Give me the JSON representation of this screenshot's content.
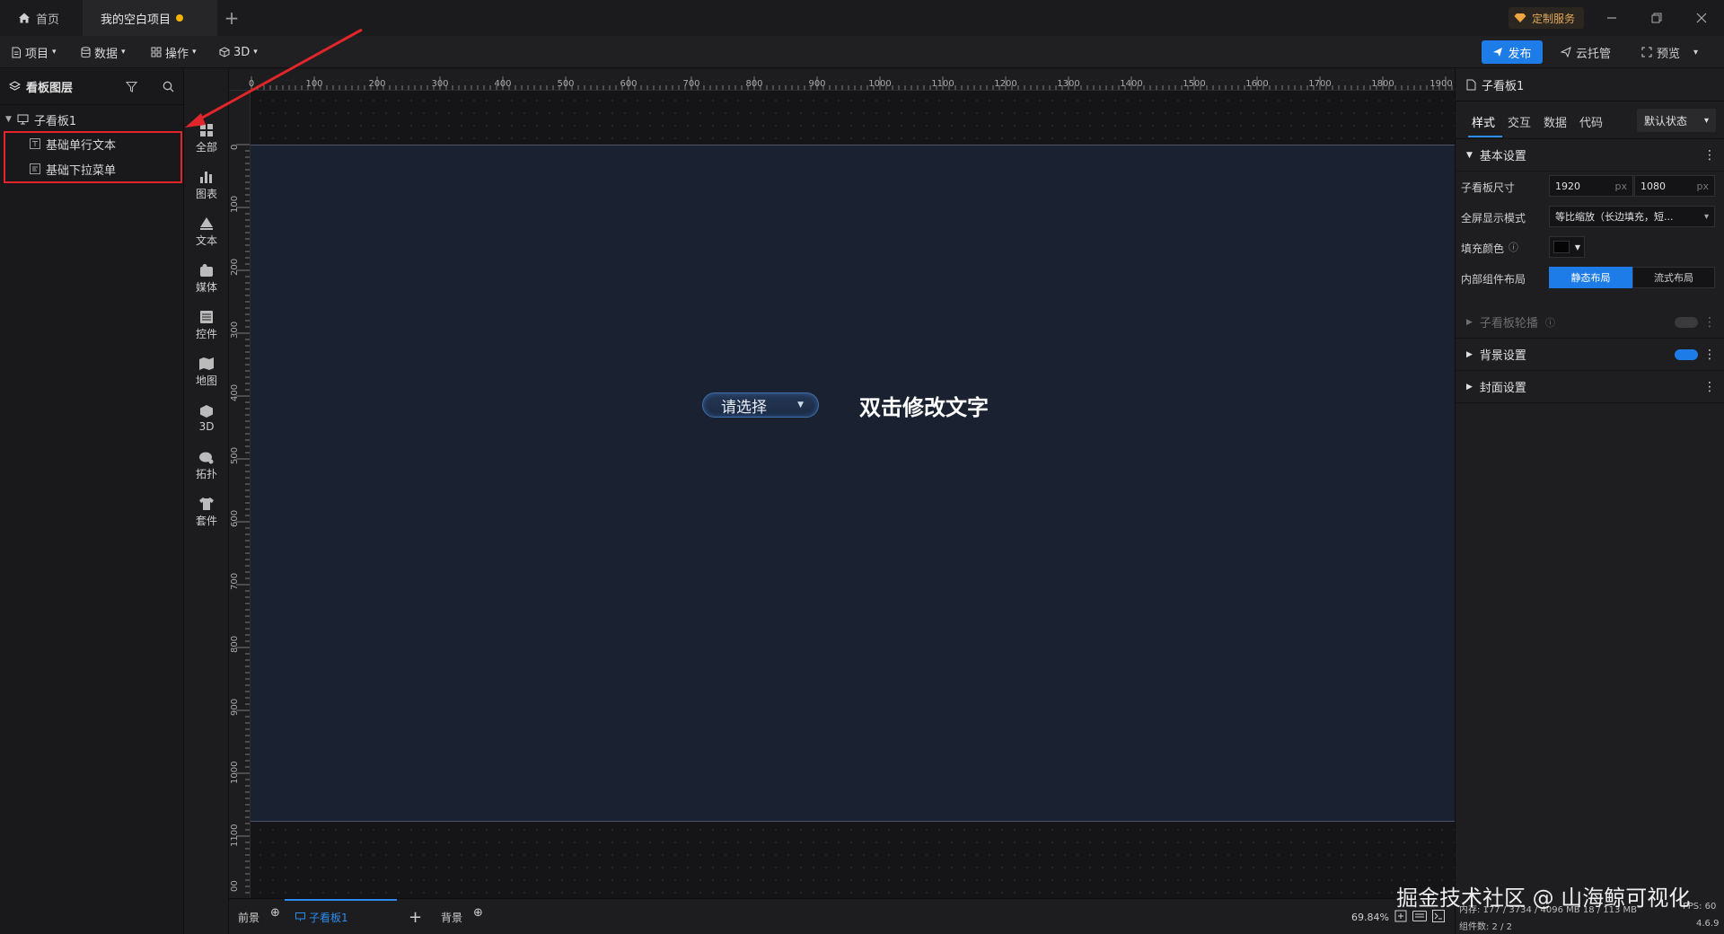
{
  "tabs": {
    "home": "首页",
    "project": "我的空白项目"
  },
  "header": {
    "custom_service": "定制服务"
  },
  "menubar": {
    "project": "项目",
    "data": "数据",
    "operate": "操作",
    "three_d": "3D",
    "publish": "发布",
    "cloud_host": "云托管",
    "preview": "预览"
  },
  "layers": {
    "title": "看板图层",
    "root": "子看板1",
    "children": [
      "基础单行文本",
      "基础下拉菜单"
    ]
  },
  "rail": [
    "全部",
    "图表",
    "文本",
    "媒体",
    "控件",
    "地图",
    "3D",
    "拓扑",
    "套件"
  ],
  "ruler": {
    "top": [
      "0",
      "100",
      "200",
      "300",
      "400",
      "500",
      "600",
      "700",
      "800",
      "900",
      "1000",
      "1100",
      "1200",
      "1300",
      "1400",
      "1500",
      "1600",
      "1700",
      "1800",
      "1900"
    ],
    "left": [
      "0",
      "100",
      "200",
      "300",
      "400",
      "500",
      "600",
      "700",
      "800",
      "900",
      "1000",
      "1100",
      "00"
    ]
  },
  "canvas": {
    "dropdown_placeholder": "请选择",
    "text": "双击修改文字"
  },
  "bottombar": {
    "foreground": "前景",
    "subboard": "子看板1",
    "background": "背景",
    "zoom": "69.84%"
  },
  "props": {
    "title": "子看板1",
    "tabs": [
      "样式",
      "交互",
      "数据",
      "代码"
    ],
    "state": "默认状态",
    "basic_section": "基本设置",
    "size_label": "子看板尺寸",
    "width": "1920",
    "height": "1080",
    "unit": "px",
    "fullscreen_label": "全屏显示模式",
    "fullscreen_value": "等比缩放（长边填充，短...",
    "fill_label": "填充颜色",
    "layout_label": "内部组件布局",
    "layout_static": "静态布局",
    "layout_flow": "流式布局",
    "carousel_section": "子看板轮播",
    "bg_section": "背景设置",
    "cover_section": "封面设置"
  },
  "status": {
    "line1": "内存: 177 / 3734 / 4096 MB  18 / 113 MB",
    "fps": "FPS: 60",
    "components": "组件数: 2 / 2",
    "version": "4.6.9"
  },
  "watermark": "掘金技术社区 @ 山海鲸可视化",
  "colors": {
    "accent": "#2d8cf0",
    "highlight": "#e0262b",
    "artboard": "#1a2231"
  }
}
